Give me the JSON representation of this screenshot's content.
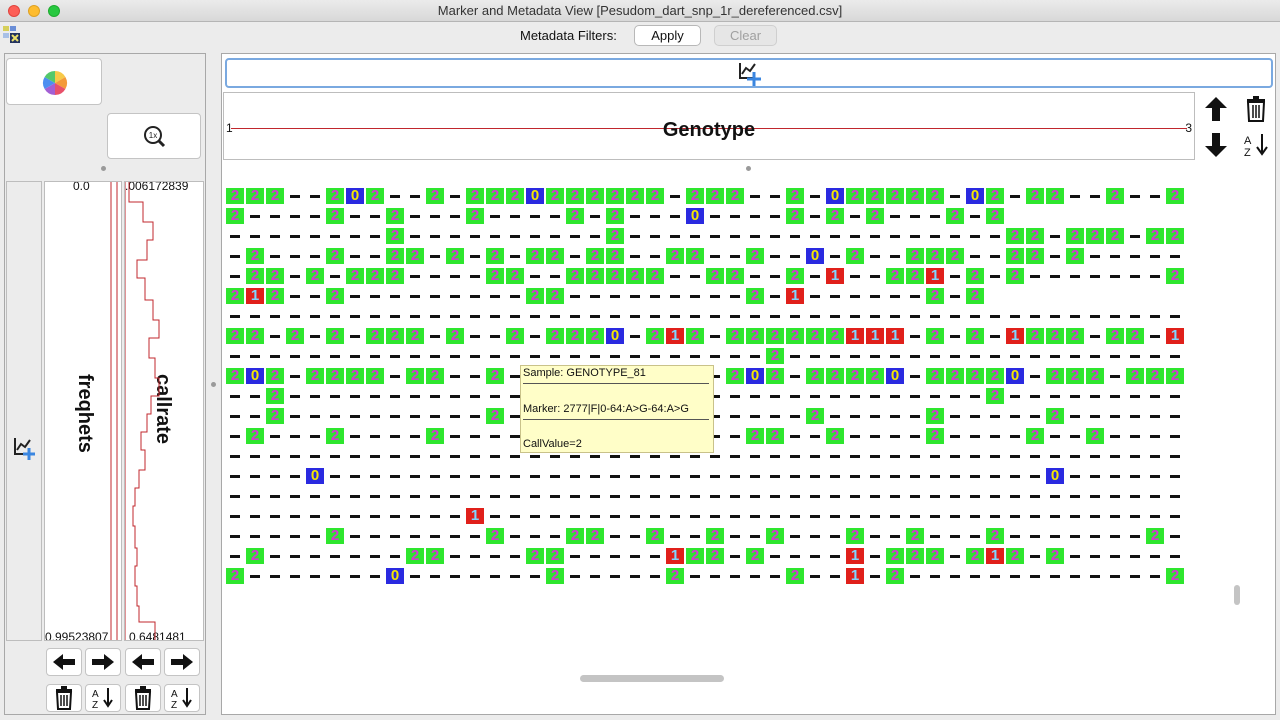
{
  "window": {
    "title": "Marker and Metadata View [Pesudom_dart_snp_1r_dereferenced.csv]"
  },
  "filters": {
    "label": "Metadata Filters:",
    "apply": "Apply",
    "clear": "Clear"
  },
  "left_panel": {
    "freqhets": {
      "label": "freqhets",
      "top": "0.0",
      "bottom": "0.99523807"
    },
    "callrate": {
      "label": "callrate",
      "top": ".006172839",
      "bottom": "0.6481481"
    },
    "zoom_badge": "1x"
  },
  "genotype_header": {
    "title": "Genotype",
    "left_value": "1",
    "right_value": "3"
  },
  "tooltip": {
    "sample": "Sample: GENOTYPE_81",
    "marker": "Marker: 2777|F|0-64:A>G-64:A>G",
    "callvalue": "CallValue=2"
  },
  "colors": {
    "het": "#2ee62e",
    "miss": "#e0201a",
    "ref": "#2a2ae0",
    "accent": "#7aa9e0"
  },
  "icons": [
    "pie-chart-icon",
    "zoom-1x-icon",
    "add-chart-icon",
    "arrow-up-icon",
    "arrow-down-icon",
    "trash-icon",
    "sort-az-icon",
    "arrow-left-icon",
    "arrow-right-icon"
  ],
  "genotype_rows": [
    "222--2o2--2-2220222222-222--2-022222-02-22--2--2-2",
    "2----2--2---2----2-2---0----2-2-2---2-2",
    "--------2----------2-------------------22-222-22-2---2--22",
    "-2---2--22-2-2-22-22--22--2--0-2--222--22-2-----2",
    "-22-2-222----22--22222--22--2-1--221-2-2-------2",
    "212--2---------22---------2-1------2-2",
    "------------------------------------------------",
    "22-2-2-222-2--2-2220-212-222222111-2-2-1222-22-1-",
    "---------------------------2--------------------",
    "202-2222-22--2-----------202-22220-22220-222-222",
    "--2-----------------------------------2----------",
    "--2----------2-2-------------2-----2-----2--------",
    "-2---2----2---------------22--2----2----2--2------",
    "------------------------------------------------",
    "----0------------------------------------0--------",
    "------------------------------------------------",
    "------------1------------------------------------",
    "-----2-------2---22--2--2--2---2--2---2-------2---2",
    "-2-------22----22-----122-2----1-222-212-2------12",
    "2-------0-------2-----2-----2--1-2-------------2--2"
  ]
}
